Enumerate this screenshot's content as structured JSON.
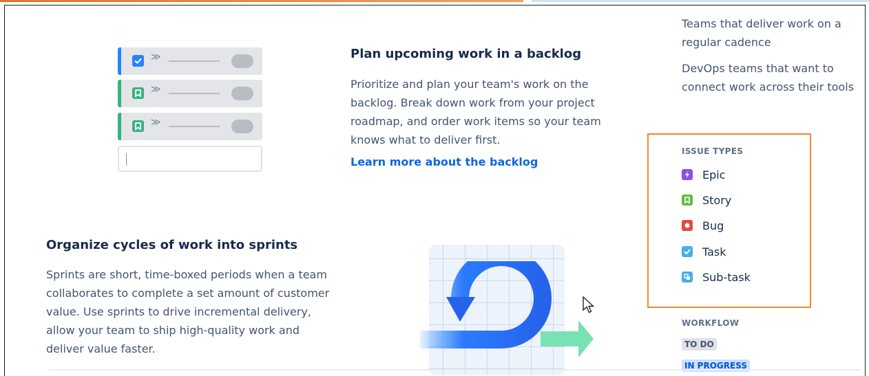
{
  "backlog": {
    "title": "Plan upcoming work in a backlog",
    "description": "Prioritize and plan your team's work on the backlog. Break down work from your project roadmap, and order work items so your team knows what to deliver first.",
    "link": "Learn more about the backlog"
  },
  "sprints": {
    "title": "Organize cycles of work into sprints",
    "description": "Sprints are short, time-boxed periods when a team collaborates to complete a set amount of customer value. Use sprints to drive incremental delivery, allow your team to ship high-quality work and deliver value faster."
  },
  "sidebar": {
    "audience_1": "Teams that deliver work on a regular cadence",
    "audience_2": "DevOps teams that want to connect work across their tools",
    "issue_types_label": "ISSUE TYPES",
    "issue_types": [
      {
        "label": "Epic",
        "icon": "epic-icon",
        "color": "#8f4ee6"
      },
      {
        "label": "Story",
        "icon": "story-icon",
        "color": "#63ba3c"
      },
      {
        "label": "Bug",
        "icon": "bug-icon",
        "color": "#e5493a"
      },
      {
        "label": "Task",
        "icon": "task-icon",
        "color": "#4bade8"
      },
      {
        "label": "Sub-task",
        "icon": "subtask-icon",
        "color": "#4bade8"
      }
    ],
    "workflow_label": "WORKFLOW",
    "workflow": [
      {
        "label": "TO DO",
        "color": "#dfe1e6"
      },
      {
        "label": "IN PROGRESS",
        "color": "#cce0ff"
      }
    ]
  },
  "colors": {
    "accent_blue": "#0c66e4",
    "highlight_orange": "#f18930",
    "backlog_row_blue": "#2684ff",
    "backlog_row_green": "#36b37e"
  }
}
